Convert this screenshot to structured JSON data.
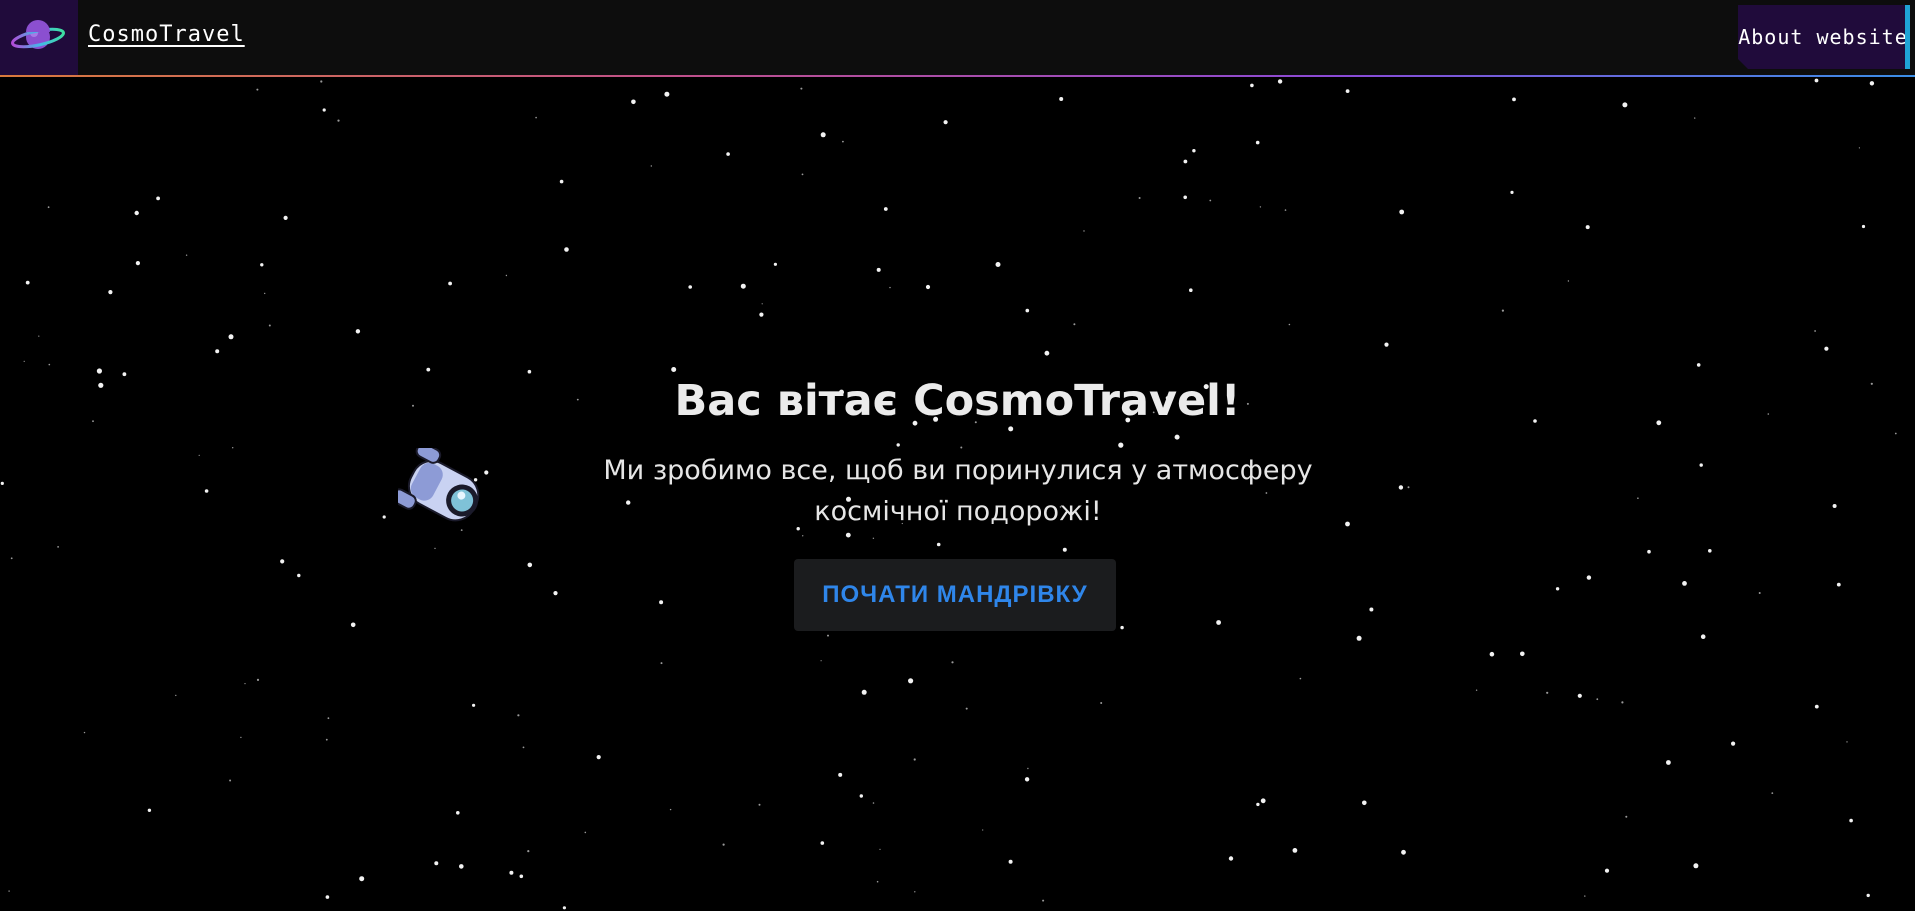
{
  "header": {
    "brand": "CosmoTravel",
    "logo_icon": "planet-ring-icon",
    "about_label": "About website"
  },
  "hero": {
    "title": "Вас вітає CosmoTravel!",
    "subtitle": "Ми зробимо все, щоб ви поринулися у атмосферу космічної подорожі!",
    "cta_label": "ПОЧАТИ МАНДРІВКУ",
    "illustration_icon": "spaceship-icon"
  },
  "colors": {
    "header_bg": "#0d0d0d",
    "accent_purple": "#200b3b",
    "accent_blue": "#1fa3d6",
    "cta_text": "#2f86ea",
    "background": "#000000"
  }
}
